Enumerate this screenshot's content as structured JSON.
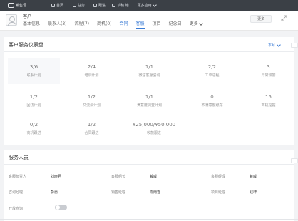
{
  "topbar": {
    "app_name": "销售号",
    "items": [
      "首页",
      "任务",
      "跟进",
      "草稿 箱",
      "更多应用"
    ]
  },
  "header": {
    "title": "客户",
    "tabs": [
      "基本信息",
      "联系人(3)",
      "流程(7)",
      "商机(0)",
      "合同",
      "客服",
      "项目",
      "纪念日",
      "更多"
    ],
    "more_button": "更多"
  },
  "dashboard": {
    "title": "客户服务仪表盘",
    "period": "本月",
    "stats": [
      {
        "value": "3/6",
        "label": "联系计划"
      },
      {
        "value": "2/4",
        "label": "培训计划"
      },
      {
        "value": "1/1",
        "label": "微信客服咨询"
      },
      {
        "value": "2/2",
        "label": "工单进程"
      },
      {
        "value": "3",
        "label": "异常预警"
      },
      {
        "value": "1/2",
        "label": "回访计划"
      },
      {
        "value": "1/2",
        "label": "交流会计划"
      },
      {
        "value": "1/1",
        "label": "满意度调查计划"
      },
      {
        "value": "0",
        "label": "不满意度跟踪"
      },
      {
        "value": "15",
        "label": "商机挖掘"
      },
      {
        "value": "0/2",
        "label": "商机跟进"
      },
      {
        "value": "1/2",
        "label": "合同跟进"
      },
      {
        "value": "¥25,000/¥50,000",
        "label": "收款跟进"
      }
    ]
  },
  "staff": {
    "title": "服务人员",
    "fields": [
      {
        "label": "客服负责人",
        "value": "刘晓君"
      },
      {
        "label": "客服组长",
        "value": "戴威"
      },
      {
        "label": "客服经理",
        "value": "戴威"
      },
      {
        "label": "咨询经理",
        "value": "彭惠"
      },
      {
        "label": "销售经理",
        "value": "陈雨雪"
      },
      {
        "label": "项目经理",
        "value": "钱坤"
      }
    ],
    "toggle_label": "开放查询",
    "toggle_on": false
  },
  "colors": {
    "accent": "#3a7bd5",
    "topbar": "#3b4046",
    "background": "#f2f3f5"
  }
}
